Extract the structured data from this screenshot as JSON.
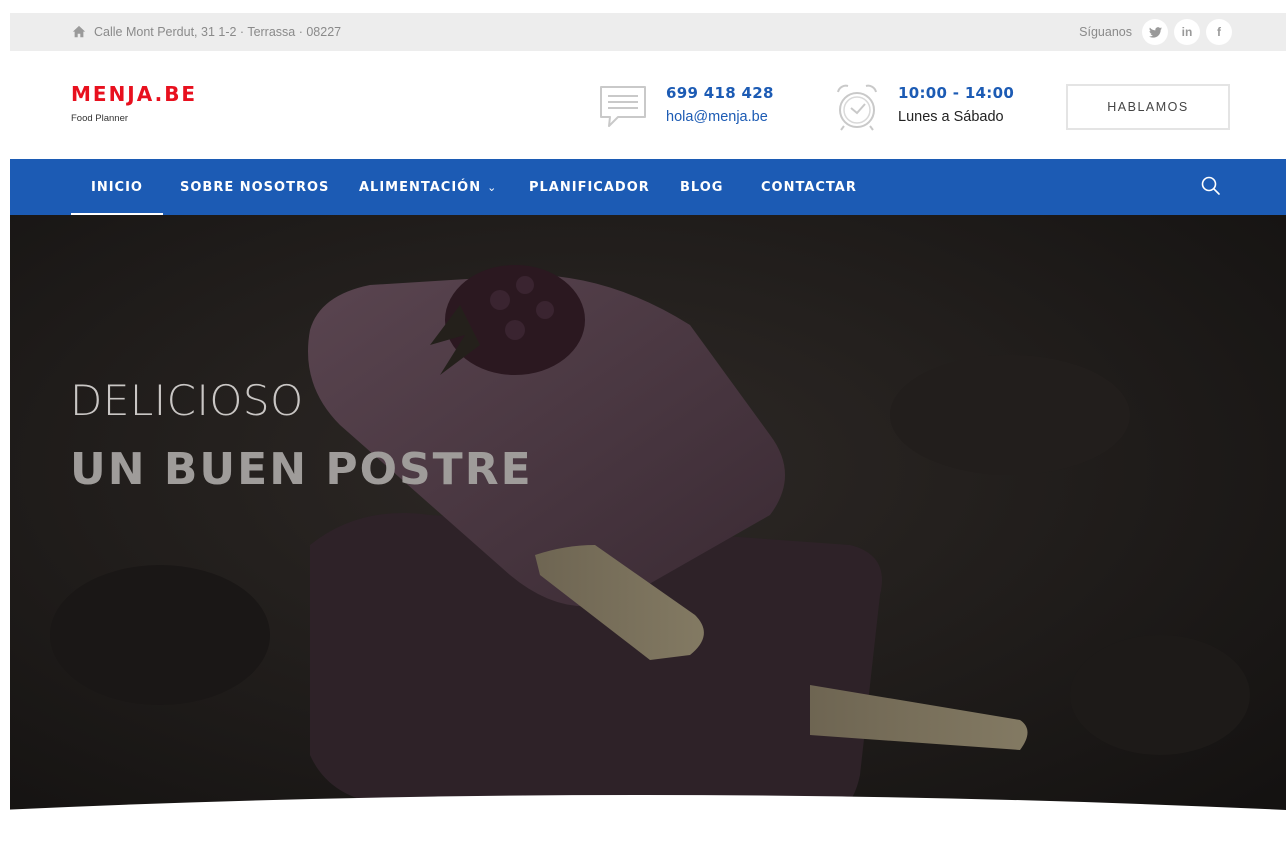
{
  "topbar": {
    "address": "Calle Mont Perdut, 31 1-2 · Terrassa · 08227",
    "follow_label": "Síguanos",
    "social": [
      {
        "name": "twitter-icon",
        "glyph": "🐦"
      },
      {
        "name": "linkedin-icon",
        "glyph": "in"
      },
      {
        "name": "facebook-icon",
        "glyph": "f"
      }
    ]
  },
  "header": {
    "logo": "MENJA.BE",
    "tagline": "Food Planner",
    "phone": "699 418 428",
    "email": "hola@menja.be",
    "hours": "10:00 - 14:00",
    "days": "Lunes a Sábado",
    "cta_label": "HABLAMOS"
  },
  "nav": {
    "items": [
      {
        "label": "INICIO",
        "active": true
      },
      {
        "label": "SOBRE NOSOTROS"
      },
      {
        "label": "ALIMENTACIÓN",
        "dropdown": true
      },
      {
        "label": "PLANIFICADOR"
      },
      {
        "label": "BLOG"
      },
      {
        "label": "CONTACTAR"
      }
    ]
  },
  "hero": {
    "line1": "DELICIOSO",
    "line2": "UN BUEN POSTRE",
    "slides": 2,
    "active_slide": 1
  },
  "colors": {
    "brand_red": "#e8101e",
    "brand_blue": "#1c5bb4",
    "topbar_bg": "#ededed"
  }
}
